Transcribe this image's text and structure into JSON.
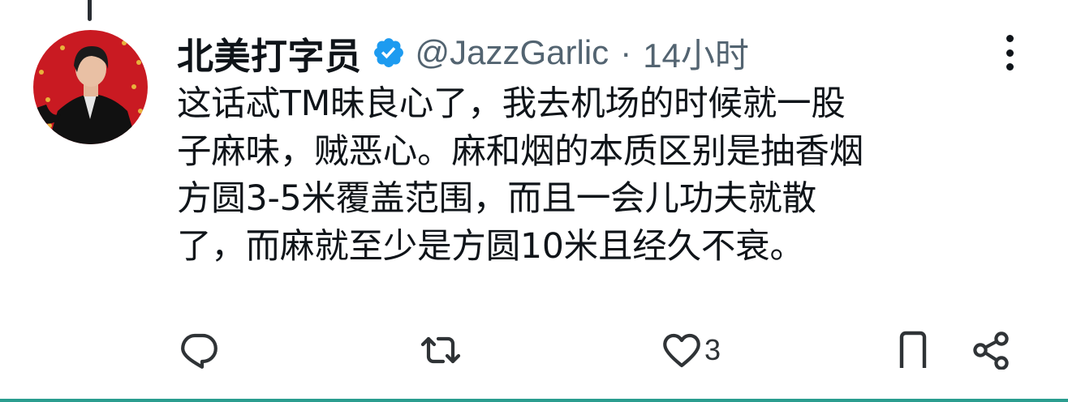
{
  "tweet": {
    "author_name": "北美打字员",
    "verified": true,
    "handle": "@JazzGarlic",
    "separator": "·",
    "time": "14小时",
    "text": "这话忒TM昧良心了，我去机场的时候就一股子麻味，贼恶心。麻和烟的本质区别是抽香烟方圆3-5米覆盖范围，而且一会儿功夫就散了，而麻就至少是方圆10米且经久不衰。",
    "text_lines": [
      "这话忒TM昧良心了，我去机场的时候就一股",
      "子麻味，贼恶心。麻和烟的本质区别是抽香烟",
      "方圆3-5米覆盖范围，而且一会儿功夫就散",
      "了，而麻就至少是方圆10米且经久不衰。"
    ],
    "like_count": "3"
  },
  "icons": {
    "verified": "verified-badge-icon",
    "more": "more-vertical-icon",
    "reply": "reply-icon",
    "retweet": "retweet-icon",
    "like": "heart-icon",
    "bookmark": "bookmark-icon",
    "share": "share-icon"
  },
  "colors": {
    "text": "#0f1419",
    "secondary": "#536471",
    "verified": "#1d9bf0",
    "bottom_bar": "#2a9d8f"
  }
}
